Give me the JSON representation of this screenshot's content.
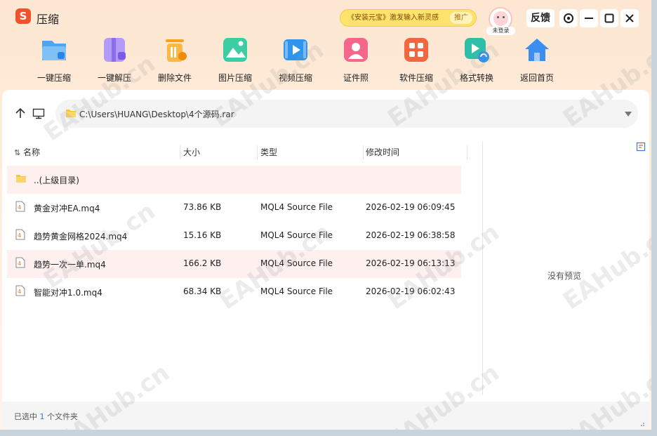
{
  "app": {
    "logo_letter": "S",
    "title": "压缩"
  },
  "promo": {
    "text": "《安装元宝》激发输入新灵感",
    "tag": "推广"
  },
  "user": {
    "login_label": "未登录"
  },
  "header": {
    "feedback_label": "反馈"
  },
  "toolbar": [
    {
      "label": "一键压缩",
      "icon": "zip-compress-icon",
      "color": "#4fa6f0"
    },
    {
      "label": "一键解压",
      "icon": "unzip-icon",
      "color": "#9b7cf2"
    },
    {
      "label": "删除文件",
      "icon": "delete-file-icon",
      "color": "#f6a21c"
    },
    {
      "label": "图片压缩",
      "icon": "image-compress-icon",
      "color": "#2fc39a"
    },
    {
      "label": "视频压缩",
      "icon": "video-compress-icon",
      "color": "#2f94ee"
    },
    {
      "label": "证件照",
      "icon": "id-photo-icon",
      "color": "#f25a7a"
    },
    {
      "label": "软件压缩",
      "icon": "software-compress-icon",
      "color": "#f2673f"
    },
    {
      "label": "格式转换",
      "icon": "format-convert-icon",
      "color": "#2fbfa8"
    },
    {
      "label": "返回首页",
      "icon": "home-icon",
      "color": "#3c8ef0"
    }
  ],
  "path": {
    "value": "C:\\Users\\HUANG\\Desktop\\4个源码.rar"
  },
  "columns": {
    "name": "名称",
    "size": "大小",
    "type": "类型",
    "modified": "修改时间"
  },
  "rows": [
    {
      "name": "..(上级目录)",
      "size": "",
      "type": "",
      "modified": "",
      "kind": "folder"
    },
    {
      "name": "黄金对冲EA.mq4",
      "size": "73.86 KB",
      "type": "MQL4 Source File",
      "modified": "2026-02-19 06:09:45",
      "kind": "file"
    },
    {
      "name": "趋势黄金网格2024.mq4",
      "size": "15.16 KB",
      "type": "MQL4 Source File",
      "modified": "2026-02-19 06:38:58",
      "kind": "file"
    },
    {
      "name": "趋势一次一单.mq4",
      "size": "166.2 KB",
      "type": "MQL4 Source File",
      "modified": "2026-02-19 06:13:13",
      "kind": "file"
    },
    {
      "name": "智能对冲1.0.mq4",
      "size": "68.34 KB",
      "type": "MQL4 Source File",
      "modified": "2026-02-19 06:02:43",
      "kind": "file"
    }
  ],
  "preview": {
    "empty_text": "没有预览"
  },
  "status": {
    "prefix": "已选中",
    "count": "1",
    "suffix": "个文件夹"
  },
  "watermark": "EAHub.cn"
}
